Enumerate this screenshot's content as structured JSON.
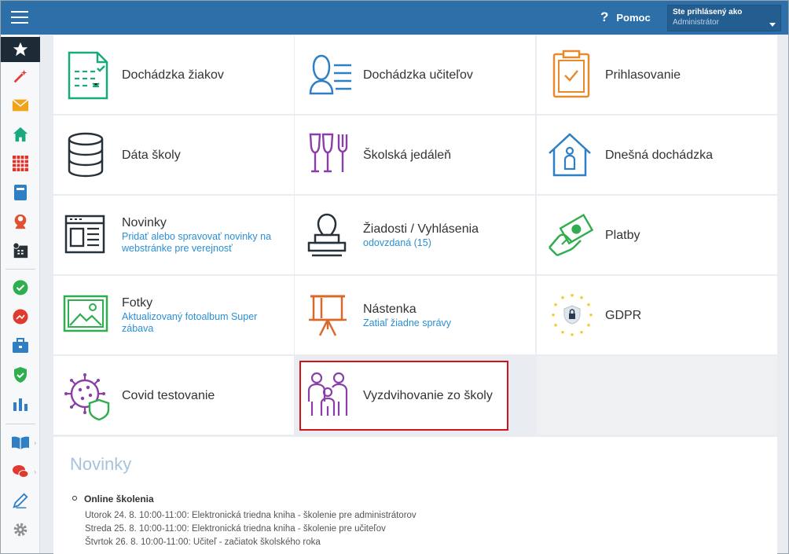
{
  "header": {
    "help_label": "Pomoc",
    "help_glyph": "?",
    "user_caption": "Ste prihlásený ako",
    "user_name": "Administrátor"
  },
  "sidebar": {
    "items": [
      {
        "name": "favorites",
        "icon": "star-icon",
        "color": "#ffffff",
        "active": true
      },
      {
        "name": "wizard",
        "icon": "magic-wand-icon",
        "color": "#e23b3b"
      },
      {
        "name": "messages",
        "icon": "envelope-icon",
        "color": "#f0a31b"
      },
      {
        "name": "home",
        "icon": "house-icon",
        "color": "#1aa87f"
      },
      {
        "name": "schedule",
        "icon": "calendar-grid-icon",
        "color": "#d9362e"
      },
      {
        "name": "notebook",
        "icon": "notebook-icon",
        "color": "#2e7fc4"
      },
      {
        "name": "users",
        "icon": "person-icon",
        "color": "#e0512f"
      },
      {
        "name": "timetable",
        "icon": "clock-calendar-icon",
        "color": "#26313a"
      },
      {
        "name": "approved",
        "icon": "check-badge-icon",
        "color": "#2fae4f"
      },
      {
        "name": "grades",
        "icon": "chart-badge-icon",
        "color": "#e0392e"
      },
      {
        "name": "portfolio",
        "icon": "briefcase-icon",
        "color": "#2e7fc4"
      },
      {
        "name": "security",
        "icon": "shield-check-icon",
        "color": "#2fae4f"
      },
      {
        "name": "statistics",
        "icon": "bar-chart-icon",
        "color": "#2e7fc4"
      },
      {
        "name": "library",
        "icon": "open-book-icon",
        "color": "#2e7fc4"
      },
      {
        "name": "chat",
        "icon": "chat-bubbles-icon",
        "color": "#e0392e"
      },
      {
        "name": "edit",
        "icon": "pencil-icon",
        "color": "#2e7fc4"
      },
      {
        "name": "settings",
        "icon": "gear-icon",
        "color": "#8a8f94"
      }
    ]
  },
  "tiles": [
    {
      "key": "dochadzka-ziakov",
      "title": "Dochádzka žiakov",
      "subtitle": "",
      "icon": "attendance-sheet-icon",
      "color": "#1aa87f"
    },
    {
      "key": "dochadzka-ucitelov",
      "title": "Dochádzka učiteľov",
      "subtitle": "",
      "icon": "teacher-list-icon",
      "color": "#2e7fc4"
    },
    {
      "key": "prihlasovanie",
      "title": "Prihlasovanie",
      "subtitle": "",
      "icon": "clipboard-check-icon",
      "color": "#e8892b"
    },
    {
      "key": "data-skoly",
      "title": "Dáta školy",
      "subtitle": "",
      "icon": "database-icon",
      "color": "#26313a"
    },
    {
      "key": "skolska-jedalen",
      "title": "Školská jedáleň",
      "subtitle": "",
      "icon": "glasses-fork-icon",
      "color": "#8a3fa8"
    },
    {
      "key": "dnesna-dochadzka",
      "title": "Dnešná dochádzka",
      "subtitle": "",
      "icon": "house-person-icon",
      "color": "#2e7fc4"
    },
    {
      "key": "novinky",
      "title": "Novinky",
      "subtitle": "Pridať alebo spravovať novinky na webstránke pre verejnosť",
      "icon": "newspaper-icon",
      "color": "#26313a"
    },
    {
      "key": "ziadosti",
      "title": "Žiadosti / Vyhlásenia",
      "subtitle": "odovzdaná (15)",
      "icon": "stamp-icon",
      "color": "#26313a"
    },
    {
      "key": "platby",
      "title": "Platby",
      "subtitle": "",
      "icon": "hand-money-icon",
      "color": "#2fae4f"
    },
    {
      "key": "fotky",
      "title": "Fotky",
      "subtitle": "Aktualizovaný fotoalbum Super zábava",
      "icon": "photo-icon",
      "color": "#2fae4f"
    },
    {
      "key": "nastenka",
      "title": "Nástenka",
      "subtitle": "Zatiaľ žiadne správy",
      "icon": "easel-icon",
      "color": "#d8692a"
    },
    {
      "key": "gdpr",
      "title": "GDPR",
      "subtitle": "",
      "icon": "eu-stars-lock-icon",
      "color": "#f3c21b"
    },
    {
      "key": "covid",
      "title": "Covid testovanie",
      "subtitle": "",
      "icon": "virus-shield-icon",
      "color": "#8a3fa8"
    },
    {
      "key": "vyzdvihovanie",
      "title": "Vyzdvihovanie zo školy",
      "subtitle": "",
      "icon": "family-icon",
      "color": "#8a3fa8",
      "highlighted": true
    }
  ],
  "news": {
    "heading": "Novinky",
    "item_title": "Online školenia",
    "lines": [
      "Utorok 24. 8. 10:00-11:00: Elektronická triedna kniha - školenie pre administrátorov",
      "Streda 25. 8. 10:00-11:00: Elektronická triedna kniha - školenie pre učiteľov",
      "Štvrtok 26. 8. 10:00-11:00: Učiteľ - začiatok školského roka"
    ]
  }
}
